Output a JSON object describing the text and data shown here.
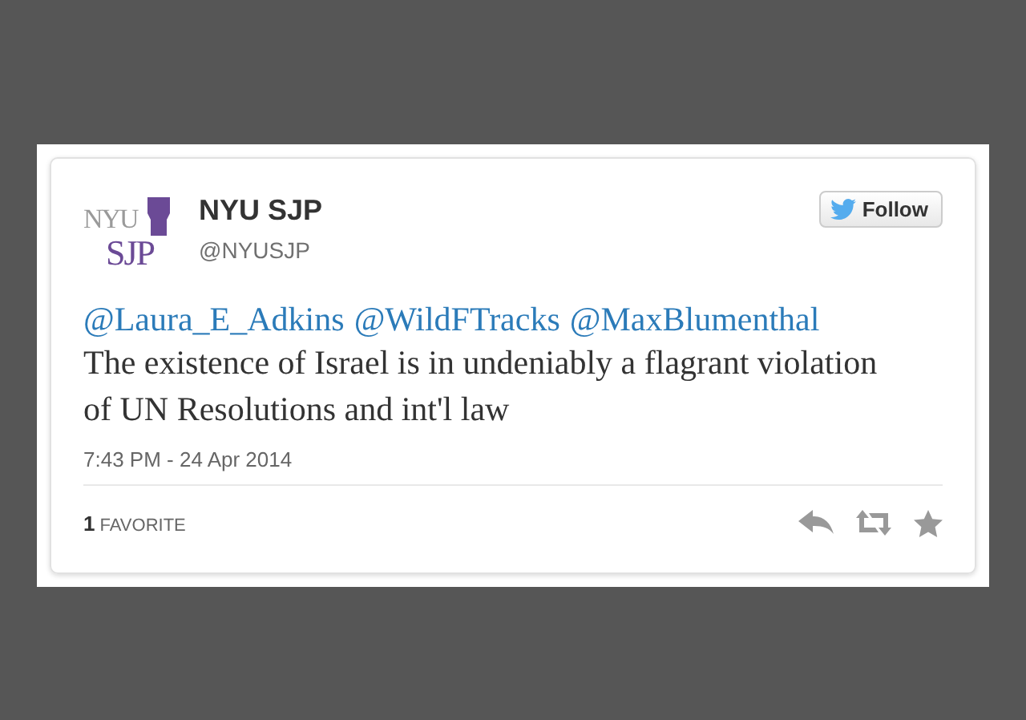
{
  "author": {
    "logo": {
      "top": "NYU",
      "bottom": "SJP"
    },
    "name": "NYU SJP",
    "handle": "@NYUSJP"
  },
  "follow_button": "Follow",
  "mentions": [
    "@Laura_E_Adkins",
    "@WildFTracks",
    "@MaxBlumenthal"
  ],
  "text": "The existence of Israel is in undeniably a flagrant violation of UN Resolutions and int'l law",
  "timestamp": "7:43 PM - 24 Apr 2014",
  "favorites": "**1** FAVORITE"
}
